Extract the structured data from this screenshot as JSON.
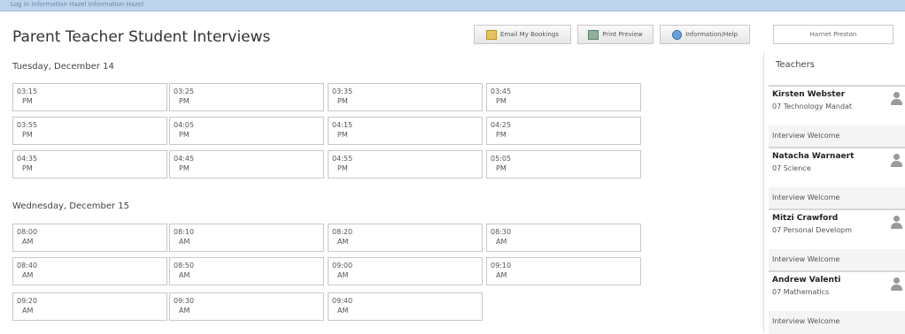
{
  "header": {
    "breadcrumb": "Log in  Information  Hazel  Information  Hazel",
    "title": "Parent Teacher Student Interviews",
    "buttons": {
      "email": "Email My Bookings",
      "print": "Print Preview",
      "help": "Information/Help"
    },
    "user_name": "Harriet Preston"
  },
  "days": [
    {
      "label": "Tuesday, December 14",
      "rows": [
        [
          {
            "time": "03:15",
            "ampm": "PM"
          },
          {
            "time": "03:25",
            "ampm": "PM"
          },
          {
            "time": "03:35",
            "ampm": "PM"
          },
          {
            "time": "03:45",
            "ampm": "PM"
          }
        ],
        [
          {
            "time": "03:55",
            "ampm": "PM"
          },
          {
            "time": "04:05",
            "ampm": "PM"
          },
          {
            "time": "04:15",
            "ampm": "PM"
          },
          {
            "time": "04:25",
            "ampm": "PM"
          }
        ],
        [
          {
            "time": "04:35",
            "ampm": "PM"
          },
          {
            "time": "04:45",
            "ampm": "PM"
          },
          {
            "time": "04:55",
            "ampm": "PM"
          },
          {
            "time": "05:05",
            "ampm": "PM"
          }
        ]
      ]
    },
    {
      "label": "Wednesday, December 15",
      "rows": [
        [
          {
            "time": "08:00",
            "ampm": "AM"
          },
          {
            "time": "08:10",
            "ampm": "AM"
          },
          {
            "time": "08:20",
            "ampm": "AM"
          },
          {
            "time": "08:30",
            "ampm": "AM"
          }
        ],
        [
          {
            "time": "08:40",
            "ampm": "AM"
          },
          {
            "time": "08:50",
            "ampm": "AM"
          },
          {
            "time": "09:00",
            "ampm": "AM"
          },
          {
            "time": "09:10",
            "ampm": "AM"
          }
        ],
        [
          {
            "time": "09:20",
            "ampm": "AM"
          },
          {
            "time": "09:30",
            "ampm": "AM"
          },
          {
            "time": "09:40",
            "ampm": "AM"
          }
        ]
      ]
    }
  ],
  "teachers": {
    "heading": "Teachers",
    "list": [
      {
        "name": "Kirsten Webster",
        "subject": "07 Technology Mandat",
        "status": "Interview Welcome"
      },
      {
        "name": "Natacha Warnaert",
        "subject": "07 Science",
        "status": "Interview Welcome"
      },
      {
        "name": "Mitzi Crawford",
        "subject": "07 Personal Developm",
        "status": "Interview Welcome"
      },
      {
        "name": "Andrew Valenti",
        "subject": "07 Mathematics",
        "status": "Interview Welcome"
      }
    ]
  }
}
